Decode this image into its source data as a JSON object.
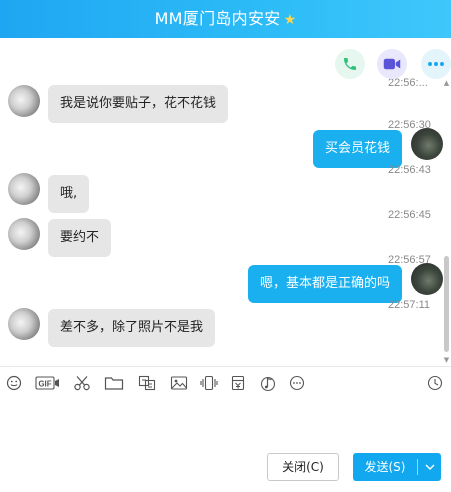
{
  "window": {
    "title": "MM厦门岛内安安",
    "title_badge": "star-icon"
  },
  "header_actions": [
    {
      "name": "voice-call-button",
      "icon": "phone-icon",
      "color": "#2ec27e"
    },
    {
      "name": "video-call-button",
      "icon": "video-icon",
      "color": "#5b54d9"
    },
    {
      "name": "more-button",
      "icon": "more-dots-icon",
      "color": "#1aa9e8"
    }
  ],
  "messages": [
    {
      "side": "in",
      "text": "我是说你要贴子，花不花钱",
      "timestamp": "22:56:..."
    },
    {
      "side": "out",
      "text": "买会员花钱",
      "timestamp": "22:56:30"
    },
    {
      "side": "in",
      "text": "哦,",
      "timestamp": "22:56:43"
    },
    {
      "side": "in",
      "text": "要约不",
      "timestamp": "22:56:45"
    },
    {
      "side": "out",
      "text": "嗯，基本都是正确的吗",
      "timestamp": "22:56:57"
    },
    {
      "side": "in",
      "text": "差不多，除了照片不是我",
      "timestamp": "22:57:11"
    }
  ],
  "toolbar": {
    "tools": [
      "emoji-icon",
      "gif-icon",
      "scissors-icon",
      "folder-icon",
      "sticker-icon",
      "image-icon",
      "screen-shake-icon",
      "red-packet-icon",
      "music-icon",
      "more-circle-icon"
    ],
    "history_icon": "clock-icon",
    "gif_label": "GIF"
  },
  "composer": {
    "value": ""
  },
  "buttons": {
    "close_label": "关闭(C)",
    "send_label": "发送(S)"
  },
  "colors": {
    "accent": "#12a8ef",
    "title_gradient_start": "#1fa6f2",
    "bubble_out": "#1ab0f0",
    "bubble_in": "#e6e6e6"
  }
}
